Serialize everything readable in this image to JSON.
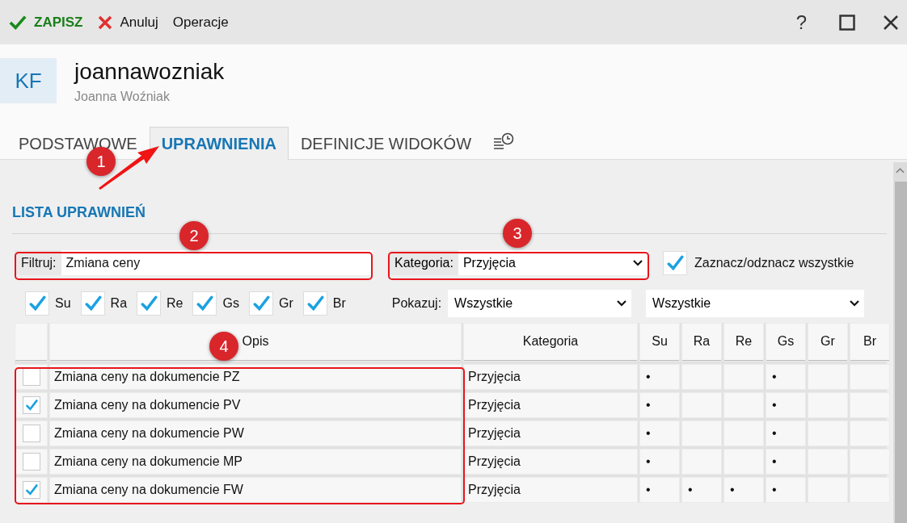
{
  "toolbar": {
    "save": "ZAPISZ",
    "cancel": "Anuluj",
    "operations": "Operacje",
    "help": "?"
  },
  "header": {
    "initials": "KF",
    "login": "joannawozniak",
    "full_name": "Joanna Woźniak"
  },
  "tabs": [
    {
      "label": "PODSTAWOWE",
      "selected": false
    },
    {
      "label": "UPRAWNIENIA",
      "selected": true
    },
    {
      "label": "DEFINICJE WIDOKÓW",
      "selected": false
    }
  ],
  "section_title": "LISTA UPRAWNIEŃ",
  "filter": {
    "label": "Filtruj:",
    "value": "Zmiana ceny"
  },
  "category": {
    "label": "Kategoria:",
    "value": "Przyjęcia"
  },
  "select_all": {
    "label": "Zaznacz/odznacz wszystkie",
    "checked": true
  },
  "column_filters": [
    {
      "label": "Su",
      "checked": true
    },
    {
      "label": "Ra",
      "checked": true
    },
    {
      "label": "Re",
      "checked": true
    },
    {
      "label": "Gs",
      "checked": true
    },
    {
      "label": "Gr",
      "checked": true
    },
    {
      "label": "Br",
      "checked": true
    }
  ],
  "show": {
    "label": "Pokazuj:",
    "value": "Wszystkie",
    "second_value": "Wszystkie"
  },
  "table": {
    "columns": [
      "Opis",
      "Kategoria",
      "Su",
      "Ra",
      "Re",
      "Gs",
      "Gr",
      "Br"
    ],
    "rows": [
      {
        "checked": false,
        "description": "Zmiana ceny na dokumencie PZ",
        "category": "Przyjęcia",
        "su": "•",
        "gs": "•"
      },
      {
        "checked": true,
        "description": "Zmiana ceny na dokumencie PV",
        "category": "Przyjęcia",
        "su": "•",
        "gs": "•"
      },
      {
        "checked": false,
        "description": "Zmiana ceny na dokumencie PW",
        "category": "Przyjęcia",
        "su": "•",
        "gs": "•"
      },
      {
        "checked": false,
        "description": "Zmiana ceny na dokumencie MP",
        "category": "Przyjęcia",
        "su": "•",
        "gs": "•"
      },
      {
        "checked": true,
        "description": "Zmiana ceny na dokumencie FW",
        "category": "Przyjęcia",
        "su": "•",
        "ra": "•",
        "re": "•",
        "gs": "•"
      }
    ]
  },
  "annotations": [
    {
      "label": "1"
    },
    {
      "label": "2"
    },
    {
      "label": "3"
    },
    {
      "label": "4"
    }
  ]
}
